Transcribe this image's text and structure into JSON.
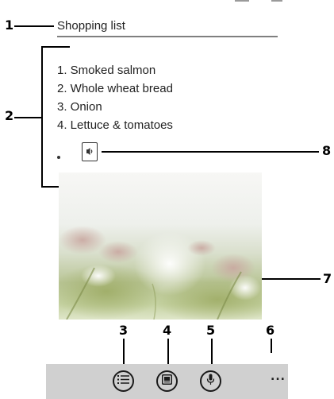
{
  "note": {
    "title": "Shopping list",
    "items": [
      "1. Smoked salmon",
      "2. Whole wheat bread",
      "3. Onion",
      "4. Lettuce & tomatoes"
    ]
  },
  "callouts": [
    "1",
    "2",
    "3",
    "4",
    "5",
    "6",
    "7",
    "8"
  ],
  "appbar": {
    "more_label": "...",
    "buttons": [
      "list-icon",
      "photo-icon",
      "microphone-icon"
    ]
  },
  "colors": {
    "appbar_bg": "#d0d0d0",
    "underline": "#7f7f7f"
  }
}
